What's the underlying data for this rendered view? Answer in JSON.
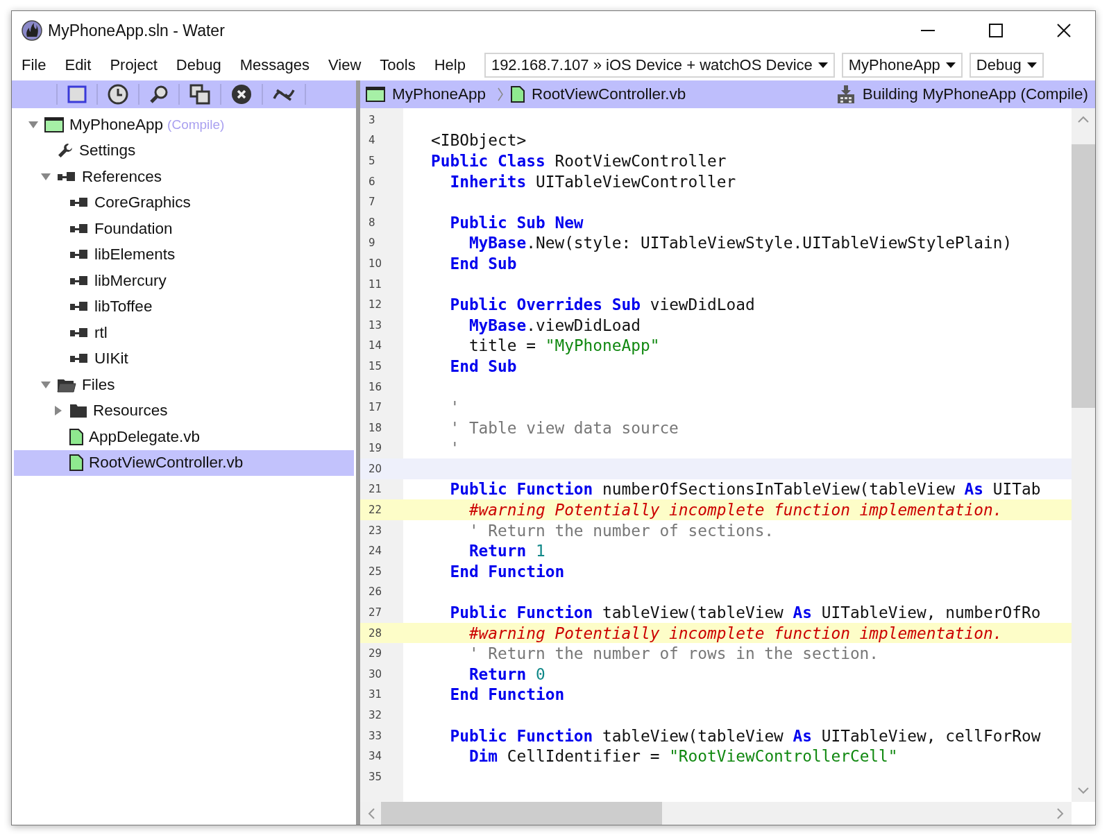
{
  "window": {
    "title": "MyPhoneApp.sln - Water"
  },
  "menu": [
    "File",
    "Edit",
    "Project",
    "Debug",
    "Messages",
    "View",
    "Tools",
    "Help"
  ],
  "dropdowns": [
    {
      "value": "192.168.7.107 » iOS Device + watchOS Device"
    },
    {
      "value": "MyPhoneApp"
    },
    {
      "value": "Debug"
    }
  ],
  "breadcrumb": [
    {
      "label": "MyPhoneApp",
      "kind": "project"
    },
    {
      "label": "RootViewController.vb",
      "kind": "file"
    }
  ],
  "build_status": "Building MyPhoneApp (Compile)",
  "tree": [
    {
      "label": "MyPhoneApp",
      "badge": "(Compile)",
      "kind": "project",
      "expanded": true,
      "selected": false,
      "children": [
        {
          "label": "Settings",
          "kind": "settings",
          "selected": false
        },
        {
          "label": "References",
          "kind": "reference",
          "expanded": true,
          "selected": false,
          "children": [
            {
              "label": "CoreGraphics",
              "kind": "reference",
              "selected": false
            },
            {
              "label": "Foundation",
              "kind": "reference",
              "selected": false
            },
            {
              "label": "libElements",
              "kind": "reference",
              "selected": false
            },
            {
              "label": "libMercury",
              "kind": "reference",
              "selected": false
            },
            {
              "label": "libToffee",
              "kind": "reference",
              "selected": false
            },
            {
              "label": "rtl",
              "kind": "reference",
              "selected": false
            },
            {
              "label": "UIKit",
              "kind": "reference",
              "selected": false
            }
          ]
        },
        {
          "label": "Files",
          "kind": "group",
          "expanded": true,
          "selected": false,
          "children": [
            {
              "label": "Resources",
              "kind": "folder",
              "expanded": false,
              "selected": false
            },
            {
              "label": "AppDelegate.vb",
              "kind": "file",
              "selected": false
            },
            {
              "label": "RootViewController.vb",
              "kind": "file",
              "selected": true
            }
          ]
        }
      ]
    }
  ],
  "code": [
    {
      "number": "3",
      "kind": "plain"
    },
    {
      "number": "4",
      "kind": "plain",
      "tokens": [
        {
          "kind": "plain",
          "text": "<IBObject>"
        }
      ]
    },
    {
      "number": "5",
      "kind": "plain",
      "tokens": [
        {
          "kind": "keyword",
          "text": "Public Class"
        },
        {
          "kind": "plain",
          "text": " RootViewController"
        }
      ]
    },
    {
      "number": "6",
      "kind": "plain",
      "tokens": [
        {
          "kind": "keyword",
          "text": "  Inherits"
        },
        {
          "kind": "plain",
          "text": " UITableViewController"
        }
      ]
    },
    {
      "number": "7",
      "kind": "plain"
    },
    {
      "number": "8",
      "kind": "plain",
      "tokens": [
        {
          "kind": "keyword",
          "text": "  Public Sub New"
        }
      ]
    },
    {
      "number": "9",
      "kind": "plain",
      "tokens": [
        {
          "kind": "keyword",
          "text": "    MyBase"
        },
        {
          "kind": "plain",
          "text": ".New(style: UITableViewStyle.UITableViewStylePlain)"
        }
      ]
    },
    {
      "number": "10",
      "kind": "plain",
      "tokens": [
        {
          "kind": "keyword",
          "text": "  End Sub"
        }
      ]
    },
    {
      "number": "11",
      "kind": "plain"
    },
    {
      "number": "12",
      "kind": "plain",
      "tokens": [
        {
          "kind": "keyword",
          "text": "  Public Overrides Sub"
        },
        {
          "kind": "plain",
          "text": " viewDidLoad"
        }
      ]
    },
    {
      "number": "13",
      "kind": "plain",
      "tokens": [
        {
          "kind": "keyword",
          "text": "    MyBase"
        },
        {
          "kind": "plain",
          "text": ".viewDidLoad"
        }
      ]
    },
    {
      "number": "14",
      "kind": "plain",
      "tokens": [
        {
          "kind": "plain",
          "text": "    title = "
        },
        {
          "kind": "string",
          "text": "\"MyPhoneApp\""
        }
      ]
    },
    {
      "number": "15",
      "kind": "plain",
      "tokens": [
        {
          "kind": "keyword",
          "text": "  End Sub"
        }
      ]
    },
    {
      "number": "16",
      "kind": "plain"
    },
    {
      "number": "17",
      "kind": "plain",
      "tokens": [
        {
          "kind": "comment",
          "text": "  '"
        }
      ]
    },
    {
      "number": "18",
      "kind": "plain",
      "tokens": [
        {
          "kind": "comment",
          "text": "  ' Table view data source"
        }
      ]
    },
    {
      "number": "19",
      "kind": "plain",
      "tokens": [
        {
          "kind": "comment",
          "text": "  '"
        }
      ]
    },
    {
      "number": "20",
      "kind": "current"
    },
    {
      "number": "21",
      "kind": "plain",
      "tokens": [
        {
          "kind": "keyword",
          "text": "  Public Function"
        },
        {
          "kind": "plain",
          "text": " numberOfSectionsInTableView(tableView "
        },
        {
          "kind": "keyword",
          "text": "As"
        },
        {
          "kind": "plain",
          "text": " UITab"
        }
      ]
    },
    {
      "number": "22",
      "kind": "warning",
      "tokens": [
        {
          "kind": "warning",
          "text": "    #warning Potentially incomplete function implementation."
        }
      ]
    },
    {
      "number": "23",
      "kind": "plain",
      "tokens": [
        {
          "kind": "comment",
          "text": "    ' Return the number of sections."
        }
      ]
    },
    {
      "number": "24",
      "kind": "plain",
      "tokens": [
        {
          "kind": "keyword",
          "text": "    Return"
        },
        {
          "kind": "number",
          "text": " 1"
        }
      ]
    },
    {
      "number": "25",
      "kind": "plain",
      "tokens": [
        {
          "kind": "keyword",
          "text": "  End Function"
        }
      ]
    },
    {
      "number": "26",
      "kind": "plain"
    },
    {
      "number": "27",
      "kind": "plain",
      "tokens": [
        {
          "kind": "keyword",
          "text": "  Public Function"
        },
        {
          "kind": "plain",
          "text": " tableView(tableView "
        },
        {
          "kind": "keyword",
          "text": "As"
        },
        {
          "kind": "plain",
          "text": " UITableView, numberOfRo"
        }
      ]
    },
    {
      "number": "28",
      "kind": "warning",
      "tokens": [
        {
          "kind": "warning",
          "text": "    #warning Potentially incomplete function implementation."
        }
      ]
    },
    {
      "number": "29",
      "kind": "plain",
      "tokens": [
        {
          "kind": "comment",
          "text": "    ' Return the number of rows in the section."
        }
      ]
    },
    {
      "number": "30",
      "kind": "plain",
      "tokens": [
        {
          "kind": "keyword",
          "text": "    Return"
        },
        {
          "kind": "number",
          "text": " 0"
        }
      ]
    },
    {
      "number": "31",
      "kind": "plain",
      "tokens": [
        {
          "kind": "keyword",
          "text": "  End Function"
        }
      ]
    },
    {
      "number": "32",
      "kind": "plain"
    },
    {
      "number": "33",
      "kind": "plain",
      "tokens": [
        {
          "kind": "keyword",
          "text": "  Public Function"
        },
        {
          "kind": "plain",
          "text": " tableView(tableView "
        },
        {
          "kind": "keyword",
          "text": "As"
        },
        {
          "kind": "plain",
          "text": " UITableView, cellForRow"
        }
      ]
    },
    {
      "number": "34",
      "kind": "plain",
      "tokens": [
        {
          "kind": "keyword",
          "text": "    Dim"
        },
        {
          "kind": "plain",
          "text": " CellIdentifier = "
        },
        {
          "kind": "string",
          "text": "\"RootViewControllerCell\""
        }
      ]
    },
    {
      "number": "35",
      "kind": "plain"
    }
  ]
}
